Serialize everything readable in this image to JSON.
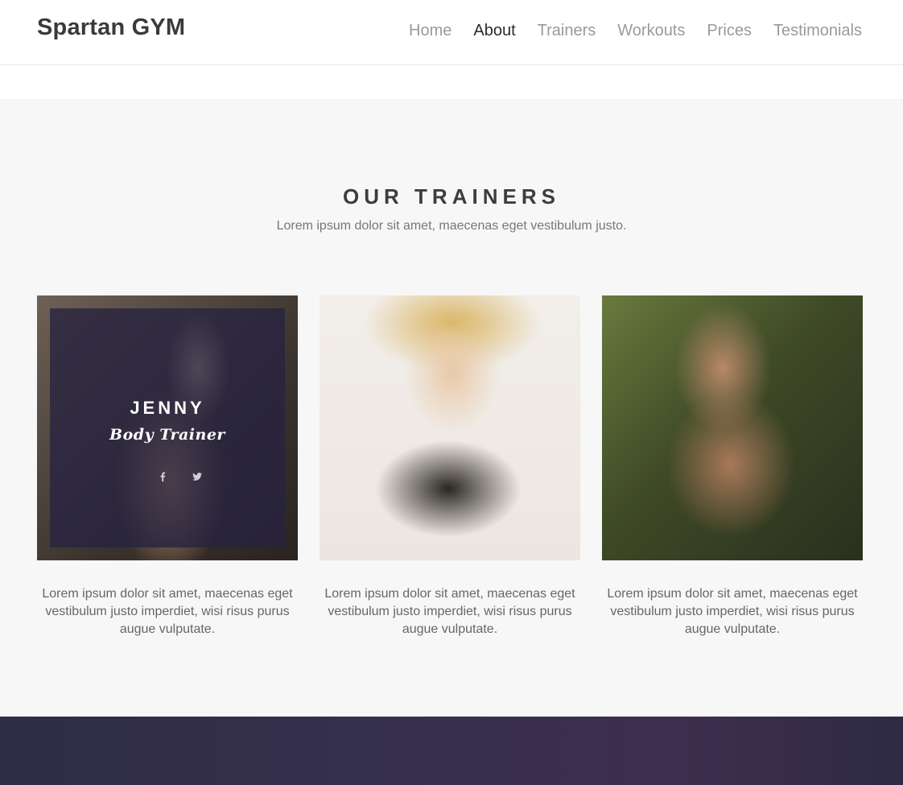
{
  "header": {
    "brand": "Spartan GYM",
    "nav": [
      {
        "label": "Home"
      },
      {
        "label": "About",
        "active": true
      },
      {
        "label": "Trainers"
      },
      {
        "label": "Workouts"
      },
      {
        "label": "Prices"
      },
      {
        "label": "Testimonials"
      }
    ]
  },
  "trainers": {
    "title": "OUR TRAINERS",
    "subtitle": "Lorem ipsum dolor sit amet, maecenas eget vestibulum justo.",
    "cards": [
      {
        "name": "JENNY",
        "role": "Body Trainer",
        "social": [
          {
            "icon": "facebook-icon"
          },
          {
            "icon": "twitter-icon"
          }
        ],
        "description": "Lorem ipsum dolor sit amet, maecenas eget vestibulum justo imperdiet, wisi risus purus augue vulputate."
      },
      {
        "description": "Lorem ipsum dolor sit amet, maecenas eget vestibulum justo imperdiet, wisi risus purus augue vulputate."
      },
      {
        "description": "Lorem ipsum dolor sit amet, maecenas eget vestibulum justo imperdiet, wisi risus purus augue vulputate."
      }
    ]
  },
  "colors": {
    "overlay": "#262240",
    "text_dark": "#3d3d3d",
    "nav_active": "#2a2a2a",
    "nav_inactive": "#9a9a9a"
  }
}
